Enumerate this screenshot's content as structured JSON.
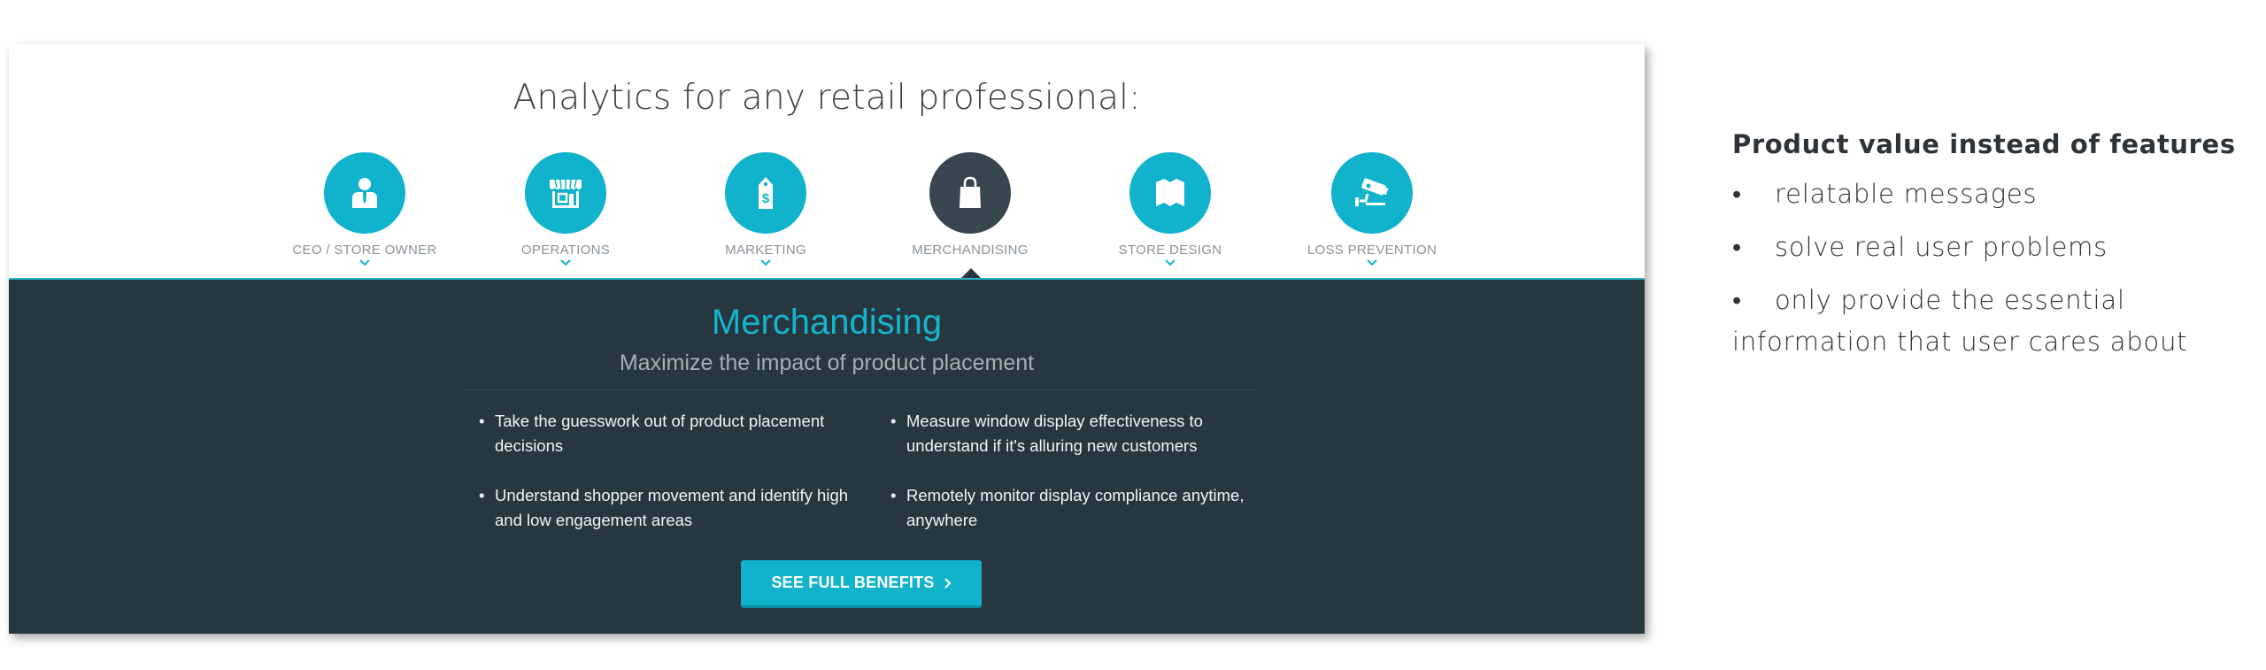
{
  "headline": "Analytics for any retail professional:",
  "roles": [
    {
      "id": "ceo",
      "label": "CEO / STORE OWNER",
      "icon": "person-icon",
      "active": false
    },
    {
      "id": "operations",
      "label": "OPERATIONS",
      "icon": "storefront-icon",
      "active": false
    },
    {
      "id": "marketing",
      "label": "MARKETING",
      "icon": "price-tag-icon",
      "active": false
    },
    {
      "id": "merchandising",
      "label": "MERCHANDISING",
      "icon": "shopping-bag-icon",
      "active": true
    },
    {
      "id": "store-design",
      "label": "STORE DESIGN",
      "icon": "map-icon",
      "active": false
    },
    {
      "id": "loss-prevention",
      "label": "LOSS PREVENTION",
      "icon": "security-camera-icon",
      "active": false
    }
  ],
  "panel": {
    "title": "Merchandising",
    "subtitle": "Maximize the impact of product placement",
    "benefits": [
      "Take the guesswork out of product placement decisions",
      "Measure window display effectiveness to understand if it's alluring new customers",
      "Understand shopper movement and identify high and low engagement areas",
      "Remotely monitor display compliance anytime, anywhere"
    ],
    "cta_label": "SEE FULL BENEFITS",
    "cta_icon": "chevron-right-icon"
  },
  "notes": {
    "title": "Product value instead of features",
    "bullet": "•",
    "items": [
      "relatable messages",
      "solve real user problems",
      "only provide the essential information that user cares about"
    ]
  },
  "colors": {
    "accent": "#10b3cb",
    "panel_bg": "#263740",
    "active_icon_bg": "#37464f"
  }
}
